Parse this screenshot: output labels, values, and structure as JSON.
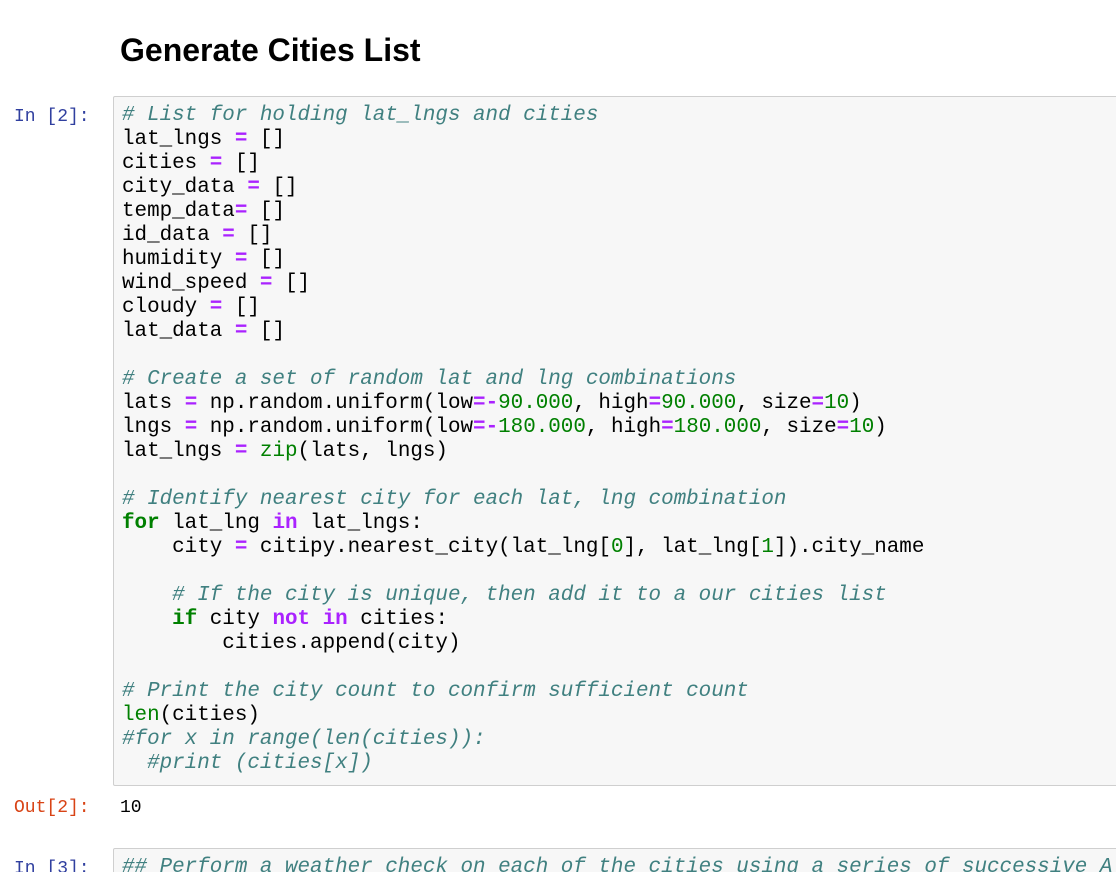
{
  "heading": "Generate Cities List",
  "cells": [
    {
      "prompt": "In [2]:",
      "lines": [
        [
          [
            "c",
            "# List for holding lat_lngs and cities"
          ]
        ],
        [
          [
            "t",
            "lat_lngs "
          ],
          [
            "o",
            "="
          ],
          [
            "t",
            " []"
          ]
        ],
        [
          [
            "t",
            "cities "
          ],
          [
            "o",
            "="
          ],
          [
            "t",
            " []"
          ]
        ],
        [
          [
            "t",
            "city_data "
          ],
          [
            "o",
            "="
          ],
          [
            "t",
            " []"
          ]
        ],
        [
          [
            "t",
            "temp_data"
          ],
          [
            "o",
            "="
          ],
          [
            "t",
            " []"
          ]
        ],
        [
          [
            "t",
            "id_data "
          ],
          [
            "o",
            "="
          ],
          [
            "t",
            " []"
          ]
        ],
        [
          [
            "t",
            "humidity "
          ],
          [
            "o",
            "="
          ],
          [
            "t",
            " []"
          ]
        ],
        [
          [
            "t",
            "wind_speed "
          ],
          [
            "o",
            "="
          ],
          [
            "t",
            " []"
          ]
        ],
        [
          [
            "t",
            "cloudy "
          ],
          [
            "o",
            "="
          ],
          [
            "t",
            " []"
          ]
        ],
        [
          [
            "t",
            "lat_data "
          ],
          [
            "o",
            "="
          ],
          [
            "t",
            " []"
          ]
        ],
        [],
        [
          [
            "c",
            "# Create a set of random lat and lng combinations"
          ]
        ],
        [
          [
            "t",
            "lats "
          ],
          [
            "o",
            "="
          ],
          [
            "t",
            " np.random.uniform(low"
          ],
          [
            "o",
            "=-"
          ],
          [
            "n",
            "90.000"
          ],
          [
            "t",
            ", high"
          ],
          [
            "o",
            "="
          ],
          [
            "n",
            "90.000"
          ],
          [
            "t",
            ", size"
          ],
          [
            "o",
            "="
          ],
          [
            "n",
            "10"
          ],
          [
            "t",
            ")"
          ]
        ],
        [
          [
            "t",
            "lngs "
          ],
          [
            "o",
            "="
          ],
          [
            "t",
            " np.random.uniform(low"
          ],
          [
            "o",
            "=-"
          ],
          [
            "n",
            "180.000"
          ],
          [
            "t",
            ", high"
          ],
          [
            "o",
            "="
          ],
          [
            "n",
            "180.000"
          ],
          [
            "t",
            ", size"
          ],
          [
            "o",
            "="
          ],
          [
            "n",
            "10"
          ],
          [
            "t",
            ")"
          ]
        ],
        [
          [
            "t",
            "lat_lngs "
          ],
          [
            "o",
            "="
          ],
          [
            "t",
            " "
          ],
          [
            "b",
            "zip"
          ],
          [
            "t",
            "(lats, lngs)"
          ]
        ],
        [],
        [
          [
            "c",
            "# Identify nearest city for each lat, lng combination"
          ]
        ],
        [
          [
            "k",
            "for"
          ],
          [
            "t",
            " lat_lng "
          ],
          [
            "ow",
            "in"
          ],
          [
            "t",
            " lat_lngs:"
          ]
        ],
        [
          [
            "t",
            "    city "
          ],
          [
            "o",
            "="
          ],
          [
            "t",
            " citipy.nearest_city(lat_lng["
          ],
          [
            "n",
            "0"
          ],
          [
            "t",
            "], lat_lng["
          ],
          [
            "n",
            "1"
          ],
          [
            "t",
            "]).city_name"
          ]
        ],
        [],
        [
          [
            "t",
            "    "
          ],
          [
            "c",
            "# If the city is unique, then add it to a our cities list"
          ]
        ],
        [
          [
            "t",
            "    "
          ],
          [
            "k",
            "if"
          ],
          [
            "t",
            " city "
          ],
          [
            "ow",
            "not"
          ],
          [
            "t",
            " "
          ],
          [
            "ow",
            "in"
          ],
          [
            "t",
            " cities:"
          ]
        ],
        [
          [
            "t",
            "        cities.append(city)"
          ]
        ],
        [],
        [
          [
            "c",
            "# Print the city count to confirm sufficient count"
          ]
        ],
        [
          [
            "b",
            "len"
          ],
          [
            "t",
            "(cities)"
          ]
        ],
        [
          [
            "c",
            "#for x in range(len(cities)):"
          ]
        ],
        [
          [
            "t",
            "  "
          ],
          [
            "c",
            "#print (cities[x])"
          ]
        ]
      ],
      "output_prompt": "Out[2]:",
      "output": "10"
    },
    {
      "prompt": "In [3]:",
      "lines": [
        [
          [
            "c",
            "## Perform a weather check on each of the cities using a series of successive A"
          ]
        ]
      ]
    }
  ],
  "syntax_colors": {
    "comment": "#408080",
    "keyword": "#008000",
    "operator": "#aa22ff",
    "number": "#008000",
    "builtin": "#008000",
    "in_prompt": "#303f9f",
    "out_prompt": "#d84315"
  }
}
